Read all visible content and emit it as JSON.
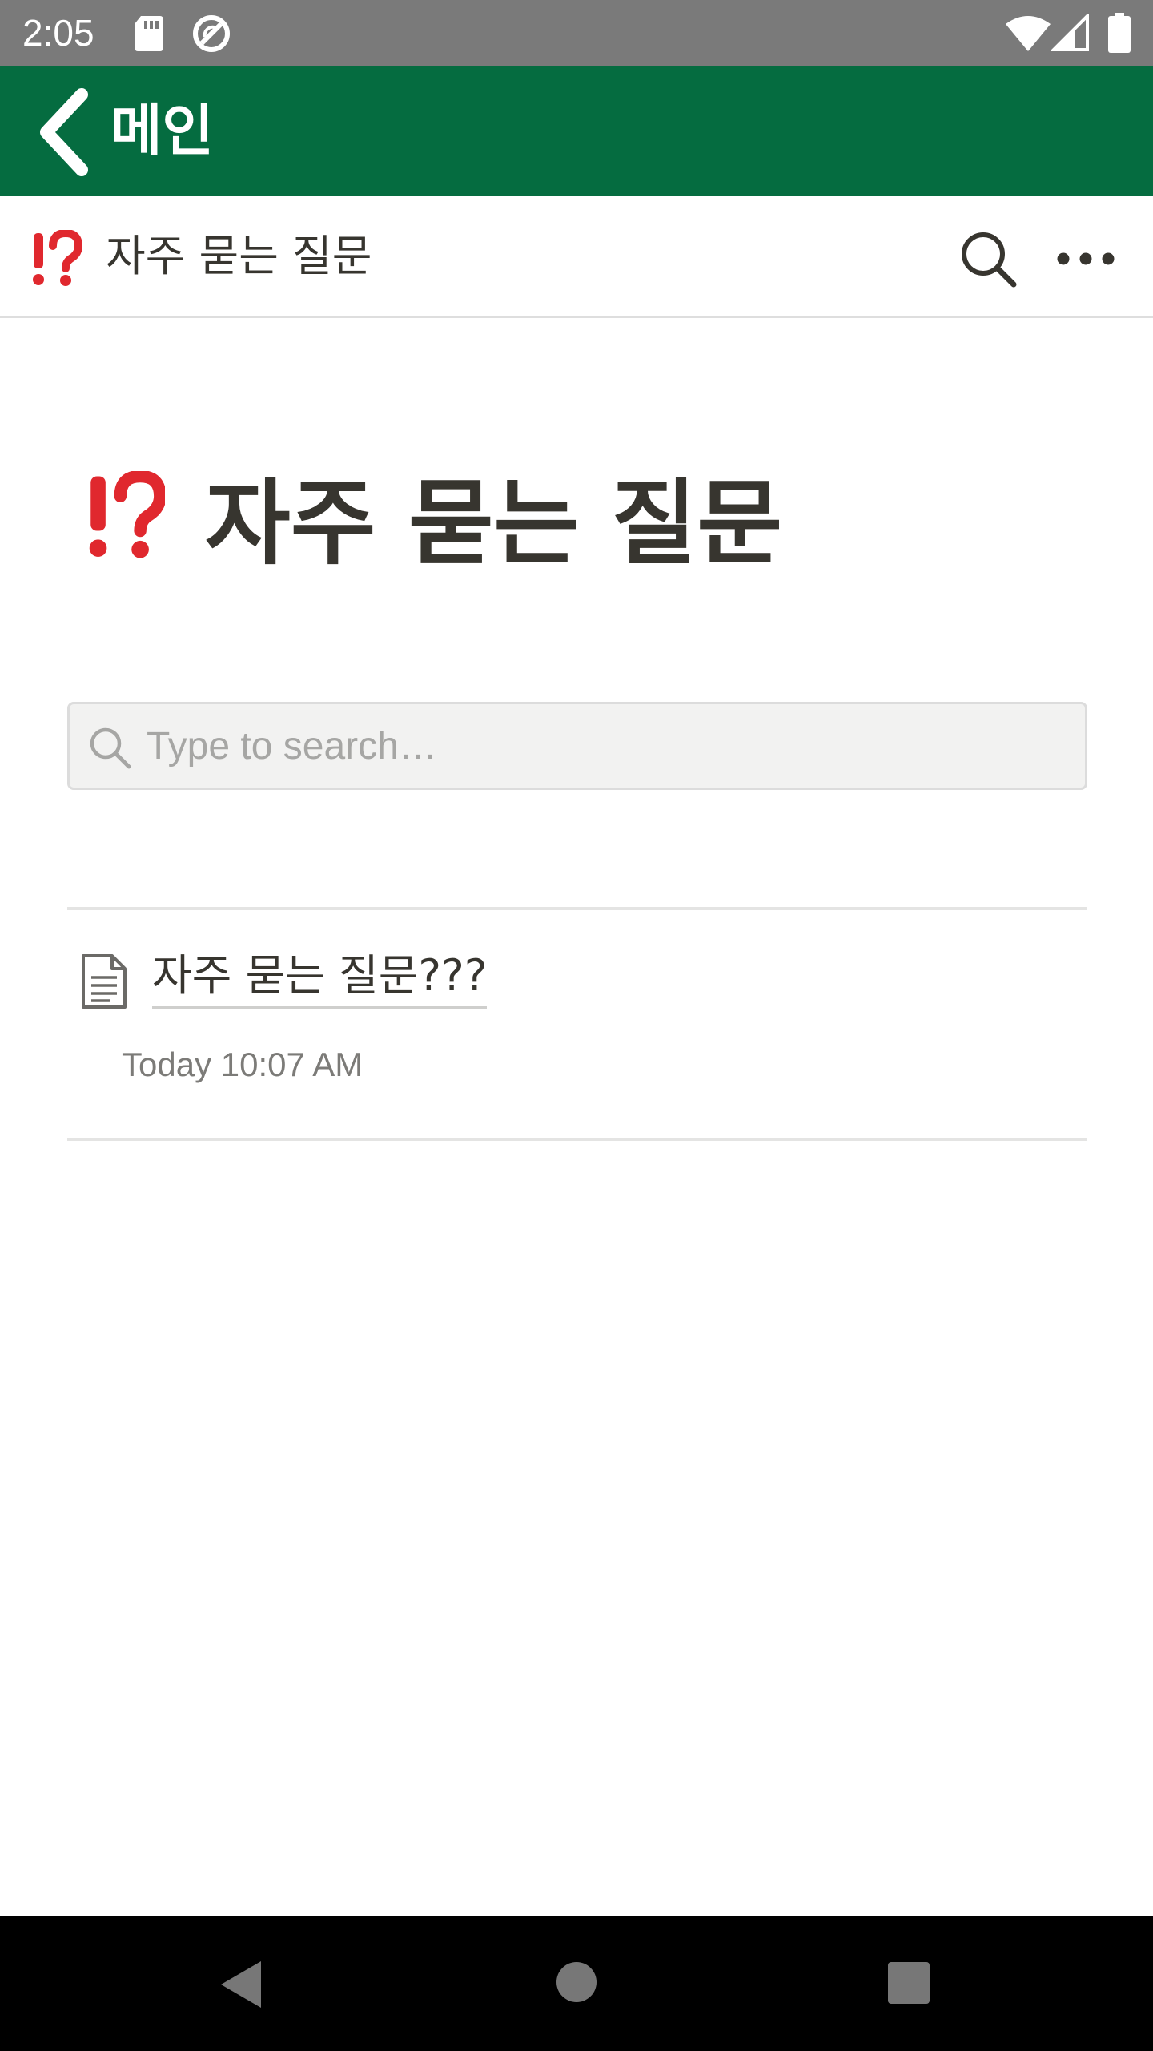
{
  "status_bar": {
    "time": "2:05",
    "icons": [
      "sd-card-icon",
      "sync-icon",
      "wifi-icon",
      "signal-icon",
      "battery-icon"
    ]
  },
  "app_bar": {
    "back_icon": "chevron-left-icon",
    "title": "메인",
    "background_color": "#056c40"
  },
  "page_header": {
    "emoji": "⁉️",
    "title": "자주 묻는 질문",
    "actions": [
      "search-icon",
      "more-icon"
    ]
  },
  "page": {
    "emoji": "⁉️",
    "title": "자주 묻는 질문",
    "search": {
      "placeholder": "Type to search…",
      "value": ""
    },
    "items": [
      {
        "icon": "document-icon",
        "title": "자주 묻는 질문???",
        "time": "Today 10:07 AM"
      }
    ]
  },
  "nav_bar": {
    "buttons": [
      "back-icon",
      "home-icon",
      "recents-icon"
    ]
  }
}
